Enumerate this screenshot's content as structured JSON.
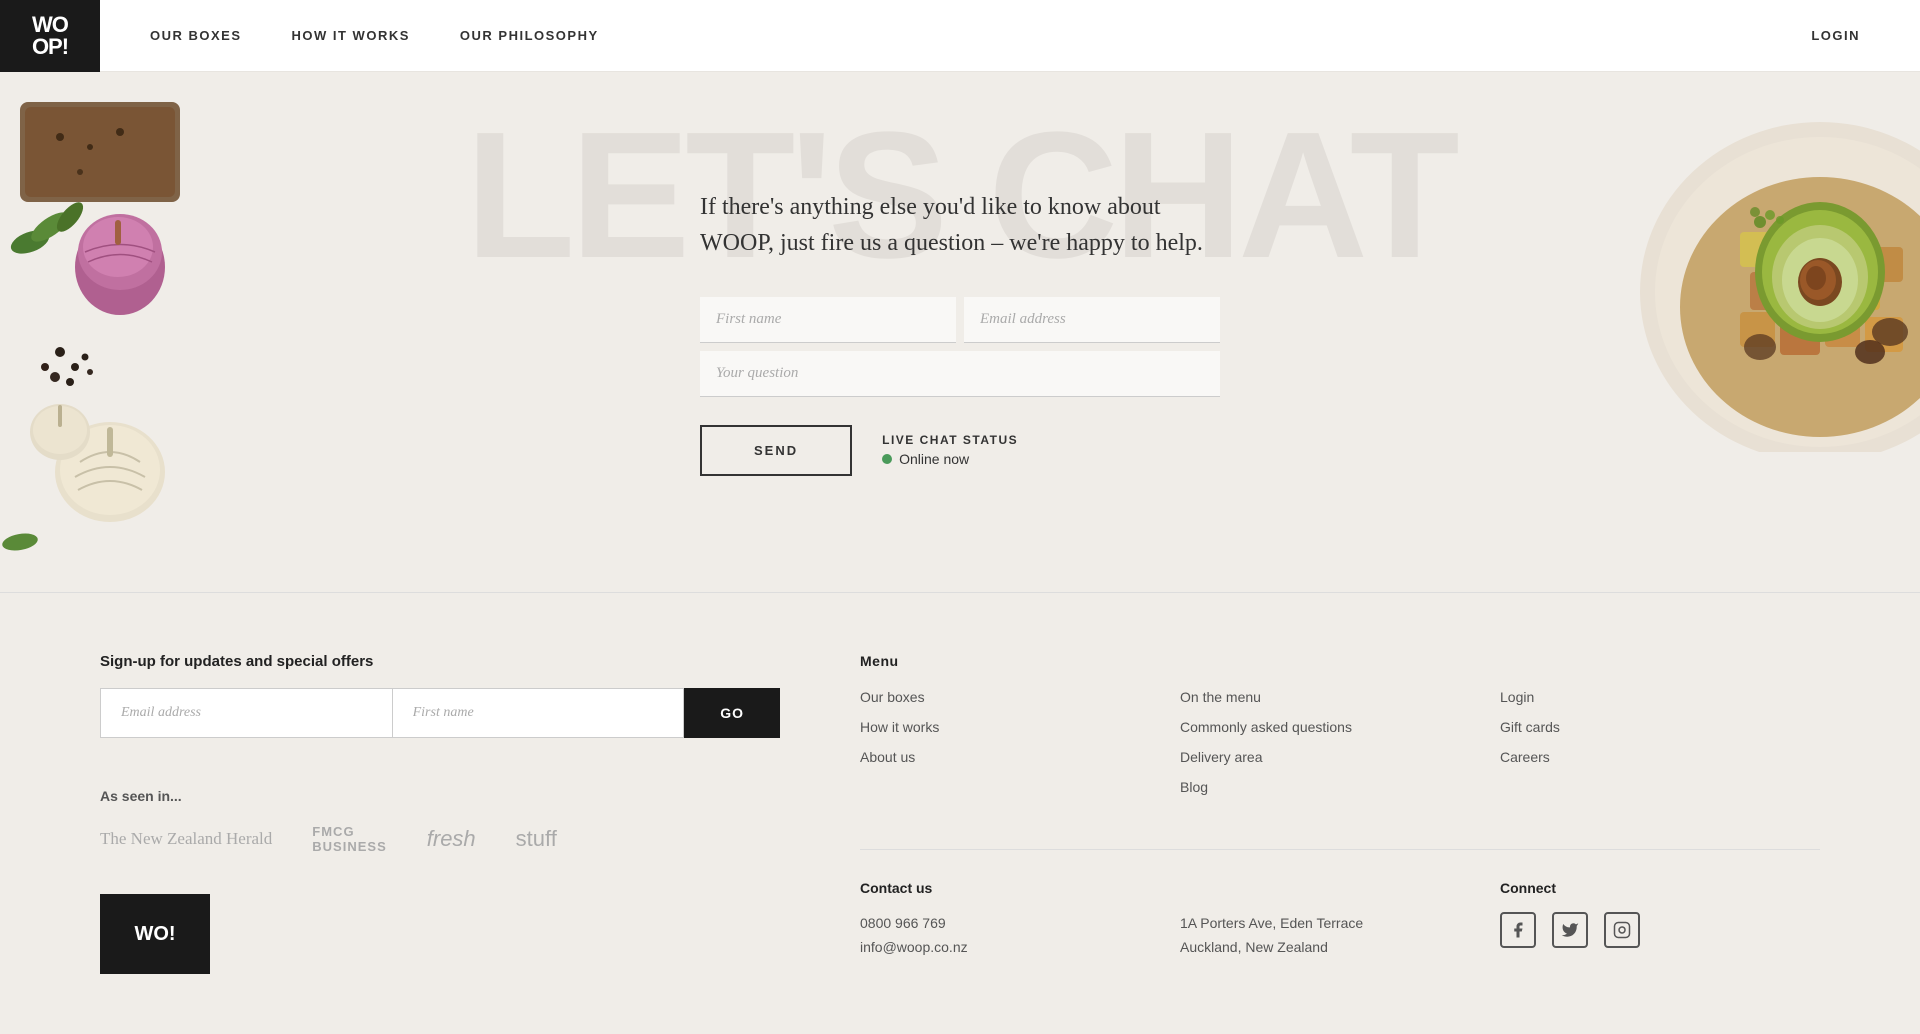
{
  "header": {
    "logo_line1": "WO",
    "logo_line2": "OP!",
    "nav": [
      {
        "id": "our-boxes",
        "label": "OUR BOXES"
      },
      {
        "id": "how-it-works",
        "label": "HOW IT WORKS"
      },
      {
        "id": "our-philosophy",
        "label": "OUR PHILOSOPHY"
      }
    ],
    "login_label": "LOGIN"
  },
  "hero": {
    "bg_text": "LET'S CHAT",
    "subtitle": "If there's anything else you'd like to know about WOOP, just fire us a question – we're happy to help.",
    "first_name_placeholder": "First name",
    "email_placeholder": "Email address",
    "question_placeholder": "Your question",
    "send_label": "SEND",
    "chat_status_label": "LIVE CHAT STATUS",
    "online_label": "Online now"
  },
  "footer": {
    "newsletter": {
      "title": "Sign-up for updates and special offers",
      "email_placeholder": "Email address",
      "name_placeholder": "First name",
      "go_label": "GO"
    },
    "seen_in": {
      "title": "As seen in...",
      "logos": [
        {
          "name": "The New Zealand Herald",
          "class": "logo-herald"
        },
        {
          "name": "FMCG\nBUSINESS",
          "class": "logo-fmcg"
        },
        {
          "name": "fresh",
          "class": "logo-fresh"
        },
        {
          "name": "stuff",
          "class": "logo-stuff"
        }
      ]
    },
    "bottom_logo": "WO!",
    "menu": {
      "title": "Menu",
      "col1": [
        {
          "label": "Our boxes",
          "href": "#"
        },
        {
          "label": "How it works",
          "href": "#"
        },
        {
          "label": "About us",
          "href": "#"
        }
      ],
      "col2": [
        {
          "label": "On the menu",
          "href": "#"
        },
        {
          "label": "Commonly asked questions",
          "href": "#"
        },
        {
          "label": "Delivery area",
          "href": "#"
        },
        {
          "label": "Blog",
          "href": "#"
        }
      ],
      "col3": [
        {
          "label": "Login",
          "href": "#"
        },
        {
          "label": "Gift cards",
          "href": "#"
        },
        {
          "label": "Careers",
          "href": "#"
        }
      ]
    },
    "contact": {
      "title": "Contact us",
      "phone": "0800 966 769",
      "email": "info@woop.co.nz",
      "address_line1": "1A Porters Ave, Eden Terrace",
      "address_line2": "Auckland, New Zealand"
    },
    "connect": {
      "title": "Connect",
      "facebook": "f",
      "twitter": "t",
      "instagram": "i"
    }
  }
}
